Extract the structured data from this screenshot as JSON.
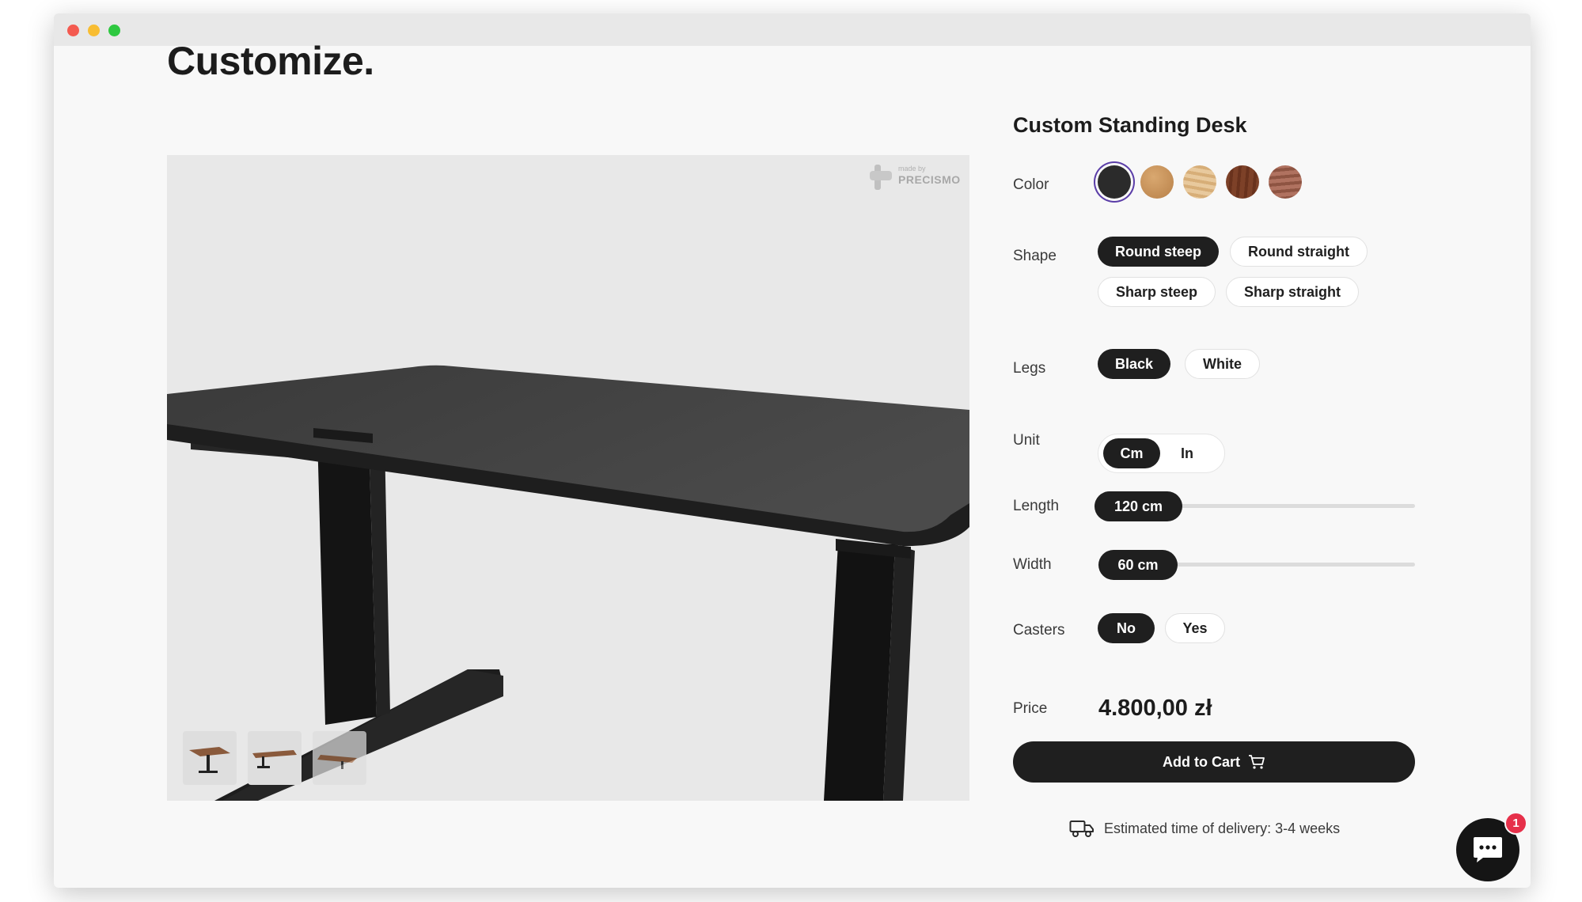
{
  "page": {
    "title": "Customize."
  },
  "viewer": {
    "watermark_small": "made by",
    "watermark_brand": "PRECISMO",
    "thumbnails": [
      "desk-view-1",
      "desk-view-2",
      "desk-view-3"
    ]
  },
  "product": {
    "title": "Custom Standing Desk",
    "color": {
      "label": "Color",
      "swatches": [
        {
          "name": "black",
          "hex": "#2b2b2b",
          "selected": true
        },
        {
          "name": "light-oak",
          "hex": "#c8955a",
          "selected": false
        },
        {
          "name": "natural-oak",
          "hex": "#e0bf8f",
          "selected": false
        },
        {
          "name": "walnut",
          "hex": "#7a3f26",
          "selected": false
        },
        {
          "name": "cherry",
          "hex": "#a36450",
          "selected": false
        }
      ]
    },
    "shape": {
      "label": "Shape",
      "options": [
        "Round steep",
        "Round straight",
        "Sharp steep",
        "Sharp straight"
      ],
      "selected": "Round steep"
    },
    "legs": {
      "label": "Legs",
      "options": [
        "Black",
        "White"
      ],
      "selected": "Black"
    },
    "unit": {
      "label": "Unit",
      "options": [
        "Cm",
        "In"
      ],
      "selected": "Cm"
    },
    "length": {
      "label": "Length",
      "value": "120 cm",
      "level": 0
    },
    "width": {
      "label": "Width",
      "value": "60 cm",
      "level": 0
    },
    "casters": {
      "label": "Casters",
      "options": [
        "No",
        "Yes"
      ],
      "selected": "No"
    },
    "price": {
      "label": "Price",
      "value": "4.800,00 zł"
    },
    "cart_button": "Add to Cart",
    "delivery": "Estimated time of delivery: 3-4 weeks"
  },
  "chat": {
    "badge": "1"
  },
  "colors": {
    "accent_dark": "#1f1f1f",
    "selected_ring": "#5b3ea8",
    "badge": "#e6304a"
  }
}
